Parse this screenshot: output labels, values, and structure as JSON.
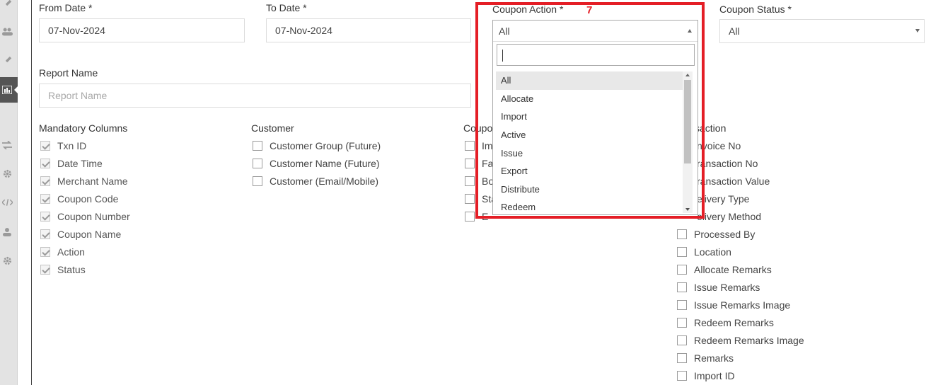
{
  "sidebar": {
    "icons": [
      "rocket-icon",
      "users-icon",
      "rocket-icon",
      "report-chart-icon",
      "transfer-icon",
      "gear-icon",
      "code-icon",
      "user-icon",
      "gear-icon"
    ]
  },
  "form": {
    "from_date": {
      "label": "From Date *",
      "value": "07-Nov-2024"
    },
    "to_date": {
      "label": "To Date *",
      "value": "07-Nov-2024"
    },
    "coupon_action": {
      "label": "Coupon Action *",
      "value": "All"
    },
    "coupon_status": {
      "label": "Coupon Status *",
      "value": "All"
    },
    "report_name": {
      "label": "Report Name",
      "placeholder": "Report Name"
    }
  },
  "dropdown": {
    "search_value": "",
    "options": [
      "All",
      "Allocate",
      "Import",
      "Active",
      "Issue",
      "Export",
      "Distribute",
      "Redeem"
    ],
    "selected": "All"
  },
  "annotation": {
    "number": "7",
    "color": "#e41e26"
  },
  "columns": {
    "mandatory": {
      "heading": "Mandatory Columns",
      "items": [
        "Txn ID",
        "Date Time",
        "Merchant Name",
        "Coupon Code",
        "Coupon Number",
        "Coupon Name",
        "Action",
        "Status"
      ]
    },
    "customer": {
      "heading": "Customer",
      "items": [
        "Customer Group (Future)",
        "Customer Name (Future)",
        "Customer (Email/Mobile)"
      ]
    },
    "coupon": {
      "heading": "Coupo",
      "items": [
        "Im",
        "Fa",
        "Bo",
        "Sta",
        "E"
      ]
    },
    "transaction": {
      "heading": "saction",
      "items": [
        "nvoice No",
        "ransaction No",
        "ransaction Value",
        "elivery Type",
        "elivery Method",
        "Processed By",
        "Location",
        "Allocate Remarks",
        "Issue Remarks",
        "Issue Remarks Image",
        "Redeem Remarks",
        "Redeem Remarks Image",
        "Remarks",
        "Import ID"
      ]
    }
  }
}
